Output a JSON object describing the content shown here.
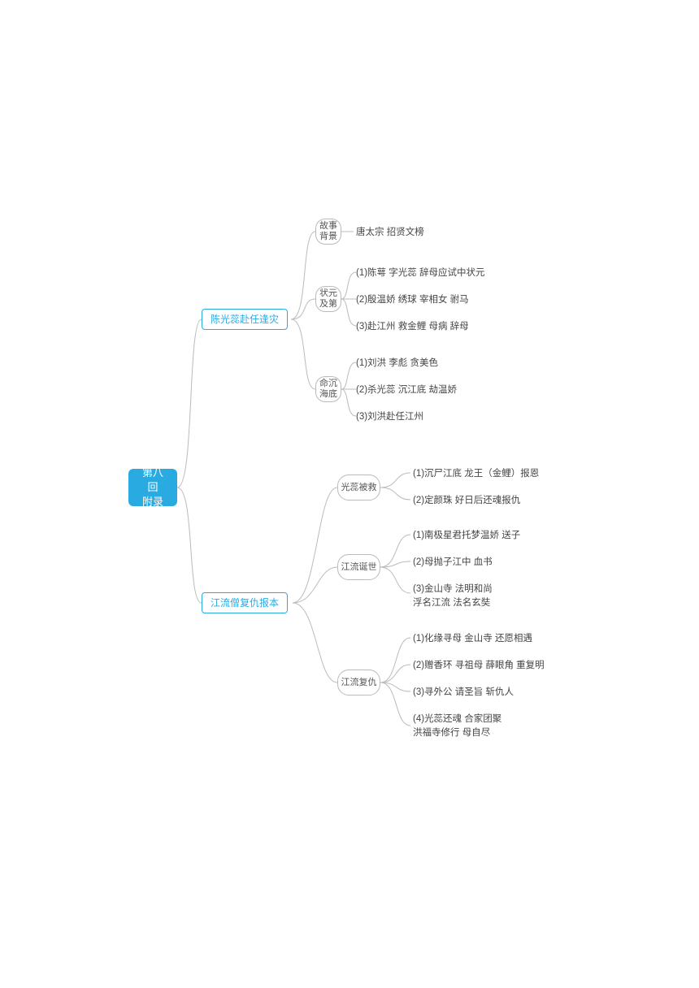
{
  "root": "第八回\n附录",
  "branches": {
    "b1": "陈光蕊赴任逢灾",
    "b2": "江流僧复仇报本"
  },
  "subs": {
    "s1": "故事\n背景",
    "s2": "状元\n及第",
    "s3": "命沉\n海底",
    "s4": "光蕊被救",
    "s5": "江流诞世",
    "s6": "江流复仇"
  },
  "leaves": {
    "l1": "唐太宗 招贤文榜",
    "l2": "(1)陈萼 字光蕊 辞母应试中状元",
    "l3": "(2)殷温娇 绣球 宰相女 驸马",
    "l4": "(3)赴江州 救金鲤 母病 辞母",
    "l5": "(1)刘洪 李彪 贪美色",
    "l6": "(2)杀光蕊 沉江底 劫温娇",
    "l7": "(3)刘洪赴任江州",
    "l8": "(1)沉尸江底 龙王（金鲤）报恩",
    "l9": "(2)定颜珠 好日后还魂报仇",
    "l10": "(1)南极星君托梦温娇 送子",
    "l11": "(2)母抛子江中 血书",
    "l12": "(3)金山寺 法明和尚\n     浮名江流 法名玄奘",
    "l13": "(1)化缘寻母 金山寺 还愿相遇",
    "l14": "(2)赠香环 寻祖母 薛眼角 重复明",
    "l15": "(3)寻外公 请圣旨 斩仇人",
    "l16": "(4)光蕊还魂 合家团聚\n     洪福寺修行 母自尽"
  }
}
